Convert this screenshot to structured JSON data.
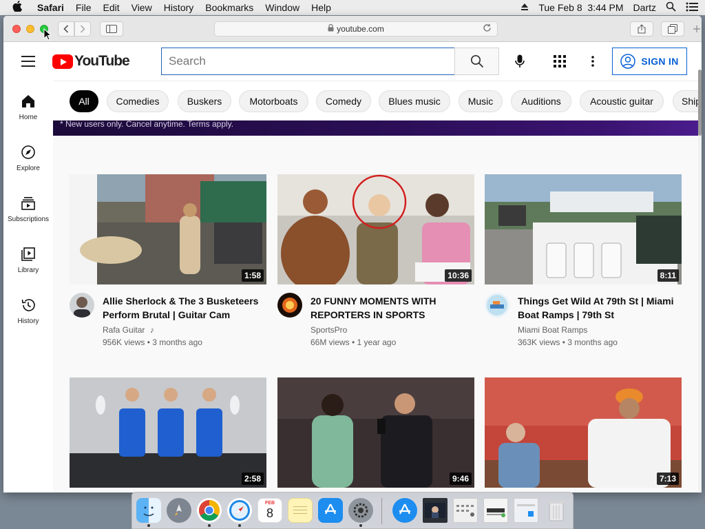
{
  "menubar": {
    "app": "Safari",
    "items": [
      "File",
      "Edit",
      "View",
      "History",
      "Bookmarks",
      "Window",
      "Help"
    ],
    "datetime": "Tue Feb 8  3:44 PM",
    "user": "Dartz"
  },
  "browser": {
    "url": "youtube.com"
  },
  "youtube": {
    "logo_text": "YouTube",
    "search_placeholder": "Search",
    "sign_in": "SIGN IN",
    "guide": [
      {
        "label": "Home",
        "icon": "home-icon"
      },
      {
        "label": "Explore",
        "icon": "compass-icon"
      },
      {
        "label": "Subscriptions",
        "icon": "subscriptions-icon"
      },
      {
        "label": "Library",
        "icon": "library-icon"
      },
      {
        "label": "History",
        "icon": "history-icon"
      }
    ],
    "chips": [
      "All",
      "Comedies",
      "Buskers",
      "Motorboats",
      "Comedy",
      "Blues music",
      "Music",
      "Auditions",
      "Acoustic guitar",
      "Ship"
    ],
    "banner_text": "* New users only. Cancel anytime. Terms apply.",
    "videos": [
      {
        "title": "Allie Sherlock & The 3 Busketeers Perform Brutal | Guitar Cam",
        "channel": "Rafa Guitar",
        "meta": "956K views • 3 months ago",
        "duration": "1:58",
        "music_note": "♪"
      },
      {
        "title": "20 FUNNY MOMENTS WITH REPORTERS IN SPORTS",
        "channel": "SportsPro",
        "meta": "66M views • 1 year ago",
        "duration": "10:36"
      },
      {
        "title": "Things Get Wild At 79th St | Miami Boat Ramps | 79th St",
        "channel": "Miami Boat Ramps",
        "meta": "363K views • 3 months ago",
        "duration": "8:11"
      },
      {
        "title": "",
        "channel": "",
        "meta": "",
        "duration": "2:58"
      },
      {
        "title": "",
        "channel": "",
        "meta": "",
        "duration": "9:46"
      },
      {
        "title": "",
        "channel": "",
        "meta": "",
        "duration": "7:13"
      }
    ]
  },
  "dock": {
    "calendar_month": "FEB",
    "calendar_day": "8",
    "apps": [
      "finder-icon",
      "launchpad-icon",
      "chrome-icon",
      "safari-icon",
      "calendar-icon",
      "notes-icon",
      "app-store-icon",
      "system-preferences-icon",
      "app-store-icon",
      "window-thumbnail",
      "window-thumbnail",
      "window-thumbnail",
      "window-thumbnail",
      "trash-icon"
    ]
  },
  "colors": {
    "youtube_red": "#ff0000",
    "accent_blue": "#065fd4",
    "active_chip": "#030303"
  }
}
